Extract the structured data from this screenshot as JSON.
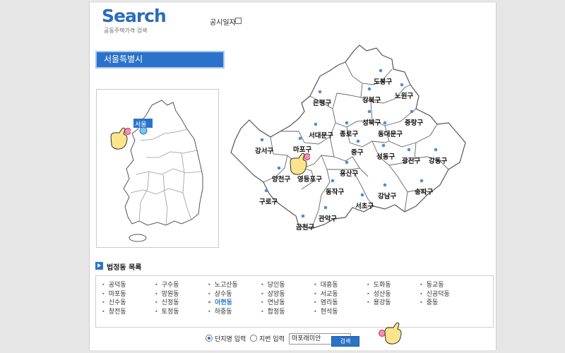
{
  "header": {
    "brand_title": "Search",
    "brand_subtitle": "공동주택가격 검색",
    "date_label": "공시일자"
  },
  "region": {
    "selected": "서울특별시"
  },
  "korea_map": {
    "seoul_label": "서울"
  },
  "seoul_districts": [
    "도봉구",
    "강북구",
    "노원구",
    "은평구",
    "성북구",
    "중랑구",
    "종로구",
    "서대문구",
    "동대문구",
    "강서구",
    "마포구",
    "중구",
    "성동구",
    "광진구",
    "강동구",
    "용산구",
    "양천구",
    "영등포구",
    "동작구",
    "송파구",
    "강남구",
    "구로구",
    "서초구",
    "관악구",
    "금천구"
  ],
  "dong_list": {
    "title": "법정동 목록",
    "items": [
      "공덕동",
      "구수동",
      "노고산동",
      "당인동",
      "대흥동",
      "도화동",
      "동교동",
      "마포동",
      "망원동",
      "상수동",
      "상암동",
      "서교동",
      "성산동",
      "신공덕동",
      "신수동",
      "신정동",
      "아현동",
      "연남동",
      "염리동",
      "용강동",
      "중동",
      "창전동",
      "토정동",
      "하중동",
      "합정동",
      "현석동"
    ],
    "active": "아현동"
  },
  "search": {
    "option1": "단지명 입력",
    "option2": "지번 입력",
    "input_value": "마포래미안",
    "button": "검색"
  },
  "colors": {
    "accent": "#2b73c9",
    "brand": "#2d6bb8",
    "map_fill": "#ffffff",
    "map_stroke": "#555555"
  }
}
